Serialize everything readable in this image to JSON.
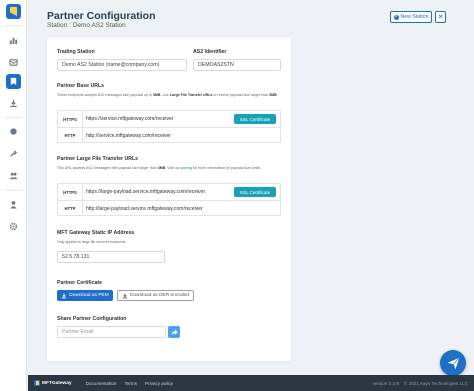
{
  "header": {
    "title": "Partner Configuration",
    "subtitle": "Station : Demo AS2 Station",
    "new_station_label": "New Station",
    "close_label": "✕"
  },
  "form": {
    "trading_station": {
      "label": "Trading Station",
      "value": "Demo AS2 Station (name@company.com)"
    },
    "as2_identifier": {
      "label": "AS2 Identifier",
      "value": "DEMOAS2STN"
    },
    "base_urls": {
      "label": "Partner Base URLs",
      "note_pre": "These endpoints accepts AS2 messages with payload up to ",
      "note_size": "3MB",
      "note_mid": ". Use ",
      "note_link_text": "Large File Transfer URLs",
      "note_post": " to receive payload size larger than ",
      "note_size2": "3MB",
      "https_label": "HTTPS",
      "https_url": "https://service.mftgateway.com/receiver",
      "http_label": "HTTP",
      "http_url": "http://service.mftgateway.com/receiver",
      "ssl_button": "SSL Certificate"
    },
    "large_urls": {
      "label": "Partner Large File Transfer URLs",
      "note_pre": "This URL accepts AS2 messages with payload size larger than ",
      "note_size": "3MB",
      "note_mid": ". Visit our ",
      "note_link_text": "pricing",
      "note_post": " for more information on payload size limits.",
      "https_label": "HTTPS",
      "https_url": "https://large-payload.service.mftgateway.com/receiver",
      "http_label": "HTTP",
      "http_url": "http://large-payload.service.mftgateway.com/receiver",
      "ssl_button": "SSL Certificate"
    },
    "static_ip": {
      "label": "MFT Gateway Static IP Address",
      "note": "Only applies to large file receiver endpoints",
      "value": "52.5.78.131"
    },
    "certificate": {
      "label": "Partner Certificate",
      "pem_button": "Download as PEM",
      "der_button": "Download as DER encoded"
    },
    "share": {
      "label": "Share Partner Configuration",
      "placeholder": "Partner Email"
    }
  },
  "footer": {
    "brand": "MFTGateway",
    "links": [
      "Documentation",
      "Terms",
      "Privacy policy"
    ],
    "version": "version 2.2.8",
    "copyright": "© 2021 Aayu Technologies LLC"
  },
  "colors": {
    "primary": "#1d6fc9",
    "info": "#17a2b8",
    "footer": "#2b3642"
  },
  "sidebar": {
    "icons": [
      "dashboard-icon",
      "messages-icon",
      "stations-icon",
      "download-icon",
      "partners-icon",
      "settings-icon",
      "users-icon",
      "account-icon",
      "gear-icon"
    ]
  }
}
